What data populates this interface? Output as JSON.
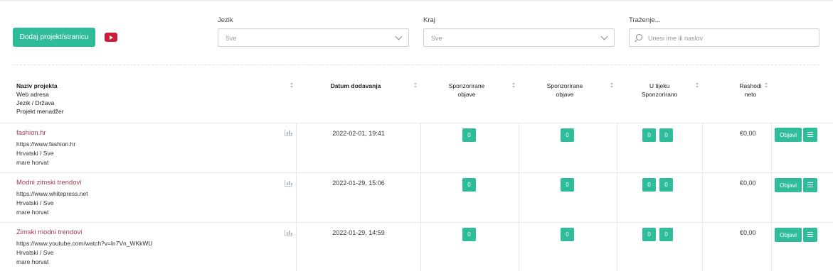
{
  "toolbar": {
    "add_label": "Dodaj projekt/stranicu",
    "video_icon": "youtube-icon"
  },
  "filters": {
    "language": {
      "label": "Jezik",
      "value": "Sve"
    },
    "country": {
      "label": "Kraj",
      "value": "Sve"
    },
    "search": {
      "label": "Traženje...",
      "placeholder": "Unesi ime ili naslov"
    }
  },
  "table": {
    "headers": {
      "project": [
        "Naziv projekta",
        "Web adresa",
        "Jezik / Država",
        "Projekt menadžer"
      ],
      "date": "Datum dodavanja",
      "sponsored1": [
        "Sponzorirane",
        "objave"
      ],
      "sponsored2": [
        "Sponzorirane",
        "objave"
      ],
      "in_progress": [
        "U tijeku",
        "Sponzorirano"
      ],
      "expenses": [
        "Rashodi",
        "neto"
      ]
    },
    "rows": [
      {
        "name": "fashion.hr",
        "url": "https://www.fashion.hr",
        "lang": "Hrvatski / Sve",
        "manager": "mare horvat",
        "date": "2022-02-01, 19:41",
        "s1": "0",
        "s2": "0",
        "p1": "0",
        "p2": "0",
        "cost": "€0,00",
        "action": "Objavi"
      },
      {
        "name": "Modni zimski trendovi",
        "url": "https://www.whitepress.net",
        "lang": "Hrvatski / Sve",
        "manager": "mare horvat",
        "date": "2022-01-29, 15:06",
        "s1": "0",
        "s2": "0",
        "p1": "0",
        "p2": "0",
        "cost": "€0,00",
        "action": "Objavi"
      },
      {
        "name": "Zimski modni trendovi",
        "url": "https://www.youtube.com/watch?v=ln7Vn_WKkWU",
        "lang": "Hrvatski / Sve",
        "manager": "mare horvat",
        "date": "2022-01-29, 14:59",
        "s1": "0",
        "s2": "0",
        "p1": "0",
        "p2": "0",
        "cost": "€0,00",
        "action": "Objavi"
      }
    ]
  },
  "colors": {
    "accent": "#2fbc9b",
    "link": "#a23a4e",
    "video": "#cc1e3a"
  }
}
